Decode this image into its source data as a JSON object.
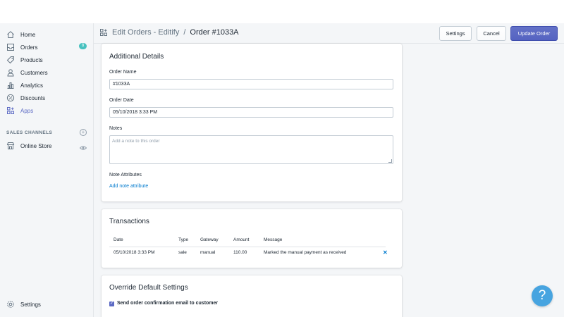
{
  "sidebar": {
    "items": [
      {
        "label": "Home",
        "icon": "home-icon"
      },
      {
        "label": "Orders",
        "icon": "orders-icon",
        "badge": "8"
      },
      {
        "label": "Products",
        "icon": "tag-icon"
      },
      {
        "label": "Customers",
        "icon": "person-icon"
      },
      {
        "label": "Analytics",
        "icon": "bar-chart-icon"
      },
      {
        "label": "Discounts",
        "icon": "discount-icon"
      },
      {
        "label": "Apps",
        "icon": "apps-icon",
        "active": true
      }
    ],
    "sales_channels_heading": "SALES CHANNELS",
    "online_store": "Online Store",
    "settings": "Settings"
  },
  "header": {
    "app_name": "Edit Orders - Editify",
    "separator": "/",
    "page": "Order #1033A",
    "buttons": {
      "settings": "Settings",
      "cancel": "Cancel",
      "update": "Update Order"
    }
  },
  "additional_details": {
    "title": "Additional Details",
    "order_name_label": "Order Name",
    "order_name_value": "#1033A",
    "order_date_label": "Order Date",
    "order_date_value": "05/10/2018  3:33 PM",
    "notes_label": "Notes",
    "notes_placeholder": "Add a note to this order",
    "note_attributes_label": "Note Attributes",
    "add_note_attribute": "Add note attribute"
  },
  "transactions": {
    "title": "Transactions",
    "columns": [
      "Date",
      "Type",
      "Gateway",
      "Amount",
      "Message"
    ],
    "rows": [
      [
        "05/10/2018 3:33 PM",
        "sale",
        "manual",
        "110.00",
        "Marked the manual payment as received"
      ]
    ],
    "delete_glyph": "✕"
  },
  "override": {
    "title": "Override Default Settings",
    "checkbox_label": "Send order confirmation email to customer",
    "checked": true
  },
  "help_glyph": "?",
  "colors": {
    "accent": "#5c6ac4",
    "link": "#007ace",
    "badge": "#47c1bf",
    "help": "#47a4e0"
  }
}
